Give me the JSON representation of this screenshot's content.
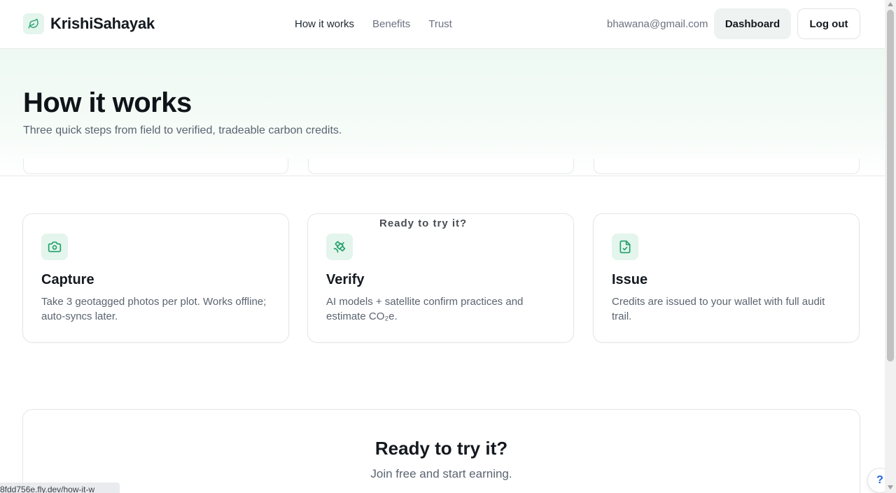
{
  "brand": {
    "name": "KrishiSahayak",
    "icon": "leaf-icon"
  },
  "nav": {
    "items": [
      {
        "label": "How it works",
        "active": true
      },
      {
        "label": "Benefits",
        "active": false
      },
      {
        "label": "Trust",
        "active": false
      }
    ]
  },
  "user": {
    "email": "bhawana@gmail.com",
    "dashboard_label": "Dashboard",
    "logout_label": "Log out"
  },
  "hero": {
    "title": "How it works",
    "subtitle": "Three quick steps from field to verified, tradeable carbon credits."
  },
  "steps": [
    {
      "icon": "camera-icon",
      "title": "Capture",
      "text": "Take 3 geotagged photos per plot. Works offline; auto-syncs later."
    },
    {
      "icon": "satellite-icon",
      "title": "Verify",
      "text": "AI models + satellite confirm practices and estimate CO₂e."
    },
    {
      "icon": "file-check-icon",
      "title": "Issue",
      "text": "Credits are issued to your wallet with full audit trail."
    }
  ],
  "cta": {
    "title": "Ready to try it?",
    "subtitle": "Join free and start earning."
  },
  "status_url": "8fdd756e.fly.dev/how-it-w",
  "help_label": "?",
  "colors": {
    "accent": "#22a06b",
    "accent_bg": "#e3f5ec",
    "help": "#2563eb"
  }
}
